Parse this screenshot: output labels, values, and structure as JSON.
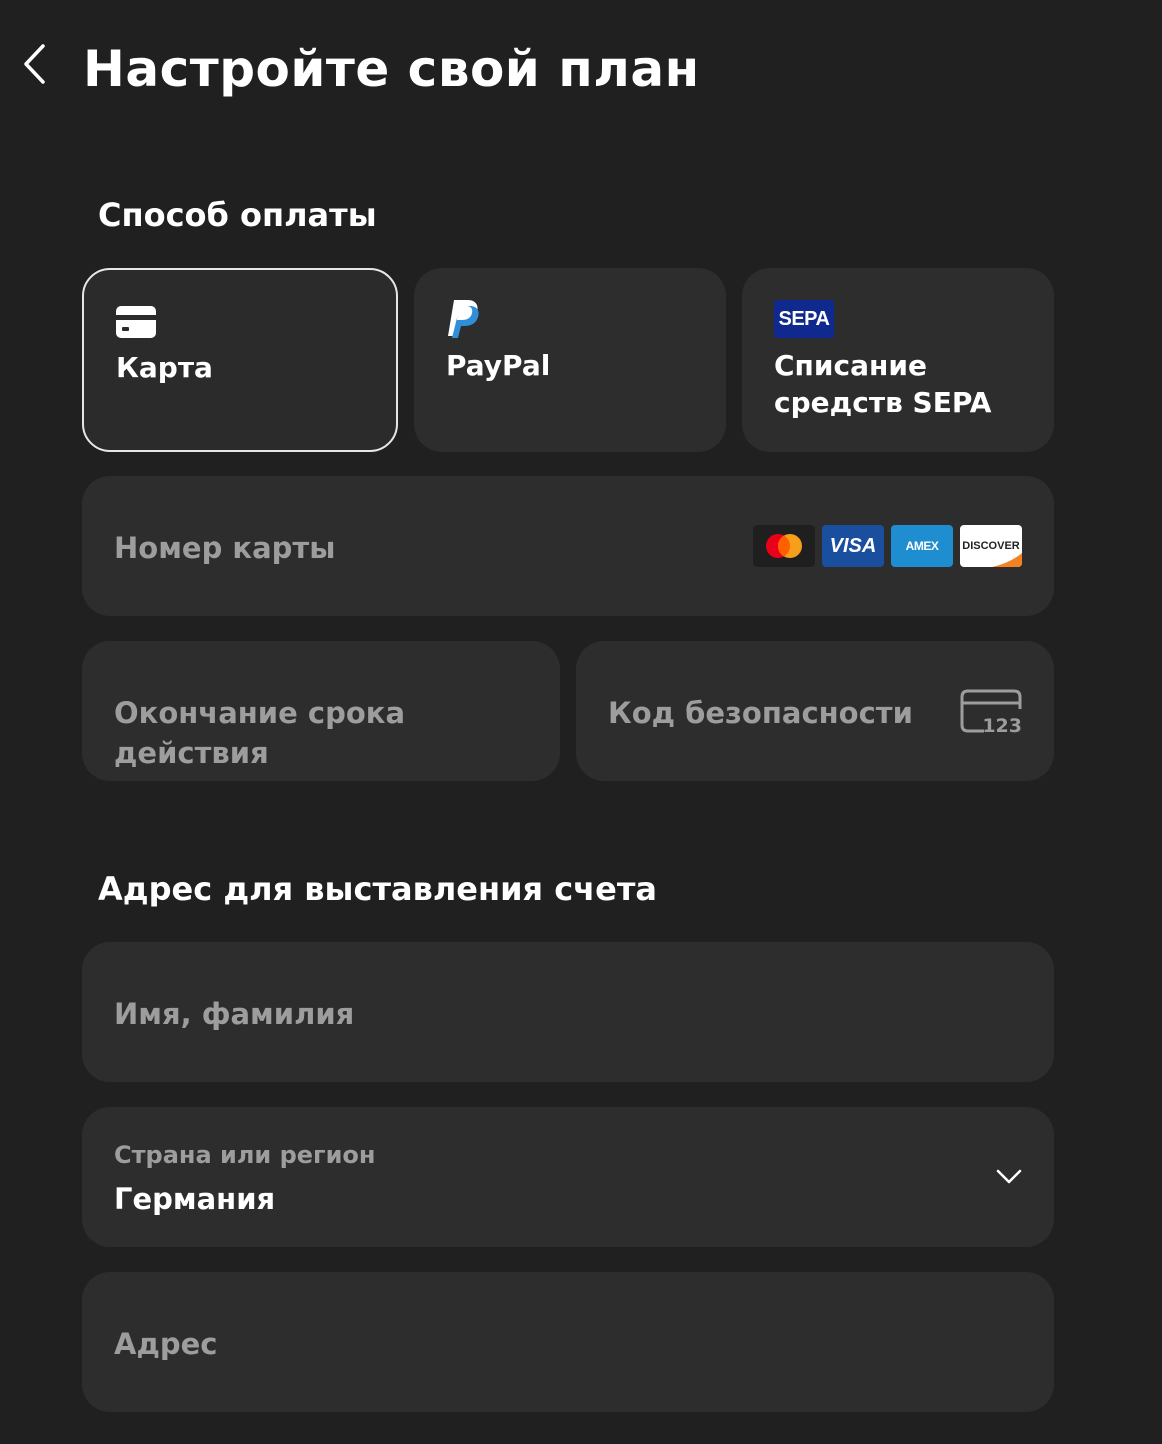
{
  "header": {
    "title": "Настройте свой план",
    "back_icon": "chevron-left-icon"
  },
  "payment": {
    "section_title": "Способ оплаты",
    "methods": [
      {
        "label": "Карта",
        "icon": "credit-card-icon",
        "selected": true
      },
      {
        "label": "PayPal",
        "icon": "paypal-icon",
        "selected": false
      },
      {
        "label_line1": "Списание",
        "label_line2": "средств SEPA",
        "icon": "sepa-icon",
        "icon_text": "SEPA",
        "selected": false
      }
    ],
    "card_number_placeholder": "Номер карты",
    "card_brands": [
      "VISA",
      "AMEX",
      "DISCOVER"
    ],
    "expiry_placeholder": "Окончание срока действия",
    "cvc_placeholder": "Код безопасности",
    "cvc_icon_text": "123"
  },
  "billing": {
    "section_title": "Адрес для выставления счета",
    "name_placeholder": "Имя, фамилия",
    "country_label": "Страна или регион",
    "country_value": "Германия",
    "address_placeholder": "Адрес"
  },
  "colors": {
    "background": "#202020",
    "field": "#2d2d2d",
    "placeholder": "#9d9d9d",
    "selected_border": "#e6e6e6"
  }
}
